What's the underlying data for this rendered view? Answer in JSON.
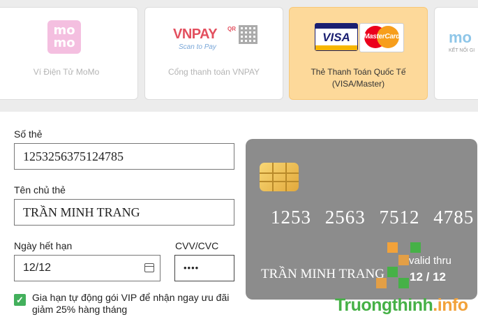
{
  "payment_methods": [
    {
      "label": "Ví Điện Tử MoMo",
      "logo_text": "mo mo"
    },
    {
      "label": "Cổng thanh toán VNPAY",
      "logo_text": "VNPAY",
      "logo_suffix": "QR",
      "logo_sub": "Scan to Pay"
    },
    {
      "label_line1": "Thẻ Thanh Toán Quốc Tế",
      "label_line2": "(VISA/Master)",
      "visa_text": "VISA",
      "mc_text": "MasterCard",
      "selected": true
    },
    {
      "logo_text": "mo",
      "logo_sub": "KẾT NỐI GI"
    }
  ],
  "form": {
    "card_number_label": "Số thẻ",
    "card_number_value": "1253256375124785",
    "holder_label": "Tên chủ thẻ",
    "holder_value": "TRẦN MINH TRANG",
    "expiry_label": "Ngày hết hạn",
    "expiry_value": "12/12",
    "cvv_label": "CVV/CVC",
    "cvv_value": "••••",
    "auto_renew_checked": true,
    "auto_renew_text": "Gia hạn tự động gói VIP để nhận ngay ưu đãi giảm 25% hàng tháng"
  },
  "card_preview": {
    "number": "1253 2563 7512 4785",
    "holder": "TRẦN MINH TRANG",
    "valid_thru_label": "valid thru",
    "valid_date": "12 / 12"
  },
  "watermark": {
    "part1": "Truongthinh",
    "part2": ".info"
  },
  "colors": {
    "selected_tab": "#fdd99a",
    "card_bg": "#8c8c8c",
    "checkbox": "#43b05c",
    "watermark_green": "#46b147",
    "watermark_orange": "#f2a23a"
  }
}
